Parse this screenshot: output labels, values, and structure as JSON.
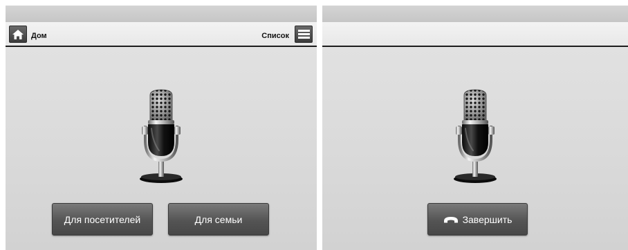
{
  "left_screen": {
    "toolbar": {
      "home_label": "Дом",
      "home_icon": "home-icon",
      "list_label": "Список",
      "list_icon": "menu-icon"
    },
    "center_icon": "microphone-icon",
    "buttons": {
      "visitors_label": "Для посетителей",
      "family_label": "Для семьи"
    }
  },
  "right_screen": {
    "center_icon": "microphone-icon",
    "end_call": {
      "label": "Завершить",
      "icon": "phone-hangup-icon"
    }
  }
}
